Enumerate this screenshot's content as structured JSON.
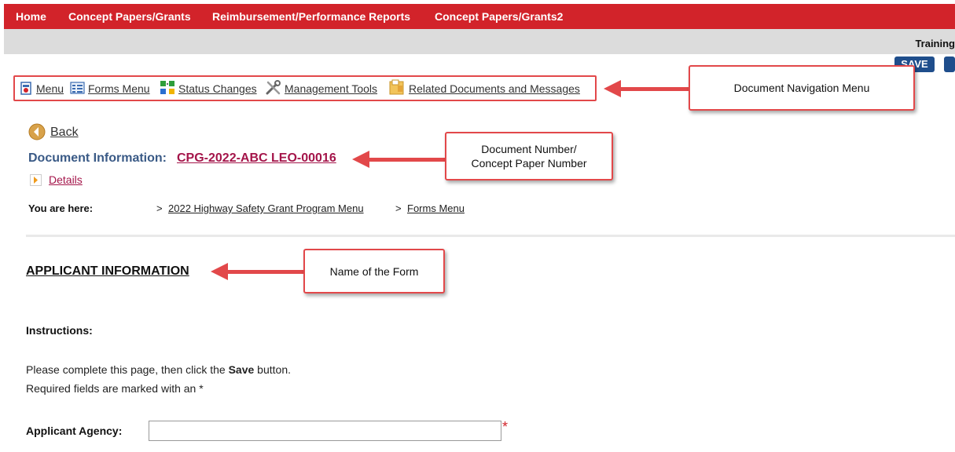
{
  "topnav": {
    "items": [
      "Home",
      "Concept Papers/Grants",
      "Reimbursement/Performance Reports",
      "Concept Papers/Grants2"
    ]
  },
  "header": {
    "user_label": "Training",
    "save_label": "SAVE"
  },
  "doc_nav": {
    "items": [
      {
        "label": "Menu",
        "icon": "document-menu-icon"
      },
      {
        "label": "Forms Menu",
        "icon": "forms-menu-icon"
      },
      {
        "label": "Status Changes",
        "icon": "status-changes-icon"
      },
      {
        "label": "Management Tools",
        "icon": "tools-icon"
      },
      {
        "label": "Related Documents and Messages",
        "icon": "related-documents-icon"
      }
    ]
  },
  "callouts": {
    "nav_menu": "Document Navigation Menu",
    "doc_number_line1": "Document Number/",
    "doc_number_line2": "Concept Paper Number",
    "form_name": "Name of the Form"
  },
  "document": {
    "back_label": "Back",
    "info_label": "Document Information:",
    "number": "CPG-2022-ABC LEO-00016",
    "details_label": "Details"
  },
  "breadcrumb": {
    "label": "You are here:",
    "items": [
      "2022 Highway Safety Grant Program Menu",
      "Forms Menu"
    ]
  },
  "form": {
    "title": "APPLICANT INFORMATION",
    "instructions_label": "Instructions:",
    "instruction_line1_pre": "Please complete this page, then click the ",
    "instruction_line1_bold": "Save",
    "instruction_line1_post": " button.",
    "instruction_line2": "Required fields are marked with an *",
    "agency_label": "Applicant Agency:",
    "agency_value": "",
    "required_marker": "*"
  },
  "colors": {
    "nav_red": "#d2232a",
    "callout_red": "#e2484a",
    "button_blue": "#1f4e8c",
    "doc_number": "#a4154a",
    "doc_info_label": "#3a5a86"
  }
}
